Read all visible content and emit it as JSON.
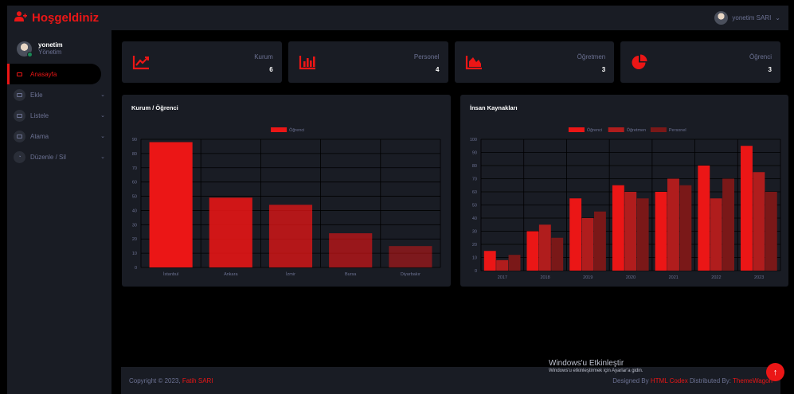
{
  "brand": {
    "title": "Hoşgeldiniz",
    "icon": "user-plus-icon"
  },
  "user": {
    "name": "yonetim",
    "role": "Yönetim",
    "status_color": "#198754"
  },
  "sidebar": {
    "items": [
      {
        "label": "Anasayfa",
        "icon": "laptop-icon",
        "active": true
      },
      {
        "label": "Ekle",
        "icon": "keyboard-icon"
      },
      {
        "label": "Listele",
        "icon": "keyboard-icon"
      },
      {
        "label": "Atama",
        "icon": "keyboard-icon"
      },
      {
        "label": "Düzenle / Sil",
        "icon": "gauge-icon"
      }
    ]
  },
  "topbar": {
    "user_label": "yonetim SARI"
  },
  "stats": [
    {
      "label": "Kurum",
      "value": "6",
      "icon": "chart-line-icon"
    },
    {
      "label": "Personel",
      "value": "4",
      "icon": "chart-bar-icon"
    },
    {
      "label": "Öğretmen",
      "value": "3",
      "icon": "chart-area-icon"
    },
    {
      "label": "Öğrenci",
      "value": "3",
      "icon": "chart-pie-icon"
    }
  ],
  "chart_data": [
    {
      "type": "bar",
      "title": "Kurum / Öğrenci",
      "categories": [
        "İstanbul",
        "Ankara",
        "İzmir",
        "Bursa",
        "Diyarbakır"
      ],
      "series": [
        {
          "name": "Öğrenci",
          "values": [
            88,
            49,
            44,
            24,
            15
          ],
          "color": "#eb1616"
        }
      ],
      "ylim": [
        0,
        90
      ],
      "yticks": [
        0,
        10,
        20,
        30,
        40,
        50,
        60,
        70,
        80,
        90
      ],
      "grid": true,
      "legend": "top"
    },
    {
      "type": "bar",
      "title": "İnsan Kaynakları",
      "categories": [
        "2017",
        "2018",
        "2019",
        "2020",
        "2021",
        "2022",
        "2023"
      ],
      "series": [
        {
          "name": "Öğrenci",
          "values": [
            15,
            30,
            55,
            65,
            60,
            80,
            95
          ],
          "color": "#eb1616"
        },
        {
          "name": "Öğretmen",
          "values": [
            8,
            35,
            40,
            60,
            70,
            55,
            75
          ],
          "color": "#b01d1d"
        },
        {
          "name": "Personel",
          "values": [
            12,
            25,
            45,
            55,
            65,
            70,
            60
          ],
          "color": "#7a1818"
        }
      ],
      "ylim": [
        0,
        100
      ],
      "yticks": [
        0,
        10,
        20,
        30,
        40,
        50,
        60,
        70,
        80,
        90,
        100
      ],
      "grid": true,
      "legend": "top"
    }
  ],
  "footer": {
    "copyright_prefix": "Copyright © 2023,",
    "author": "Fatih SARI",
    "designed_prefix": "Designed By",
    "designer": "HTML Codex",
    "distributed_prefix": "Distributed By:",
    "distributor": "ThemeWagon"
  },
  "watermark": {
    "title": "Windows'u Etkinleştir",
    "subtitle": "Windows'u etkinleştirmek için Ayarlar'a gidin."
  },
  "colors": {
    "accent": "#eb1616",
    "panel": "#191c24",
    "background": "#000000"
  }
}
